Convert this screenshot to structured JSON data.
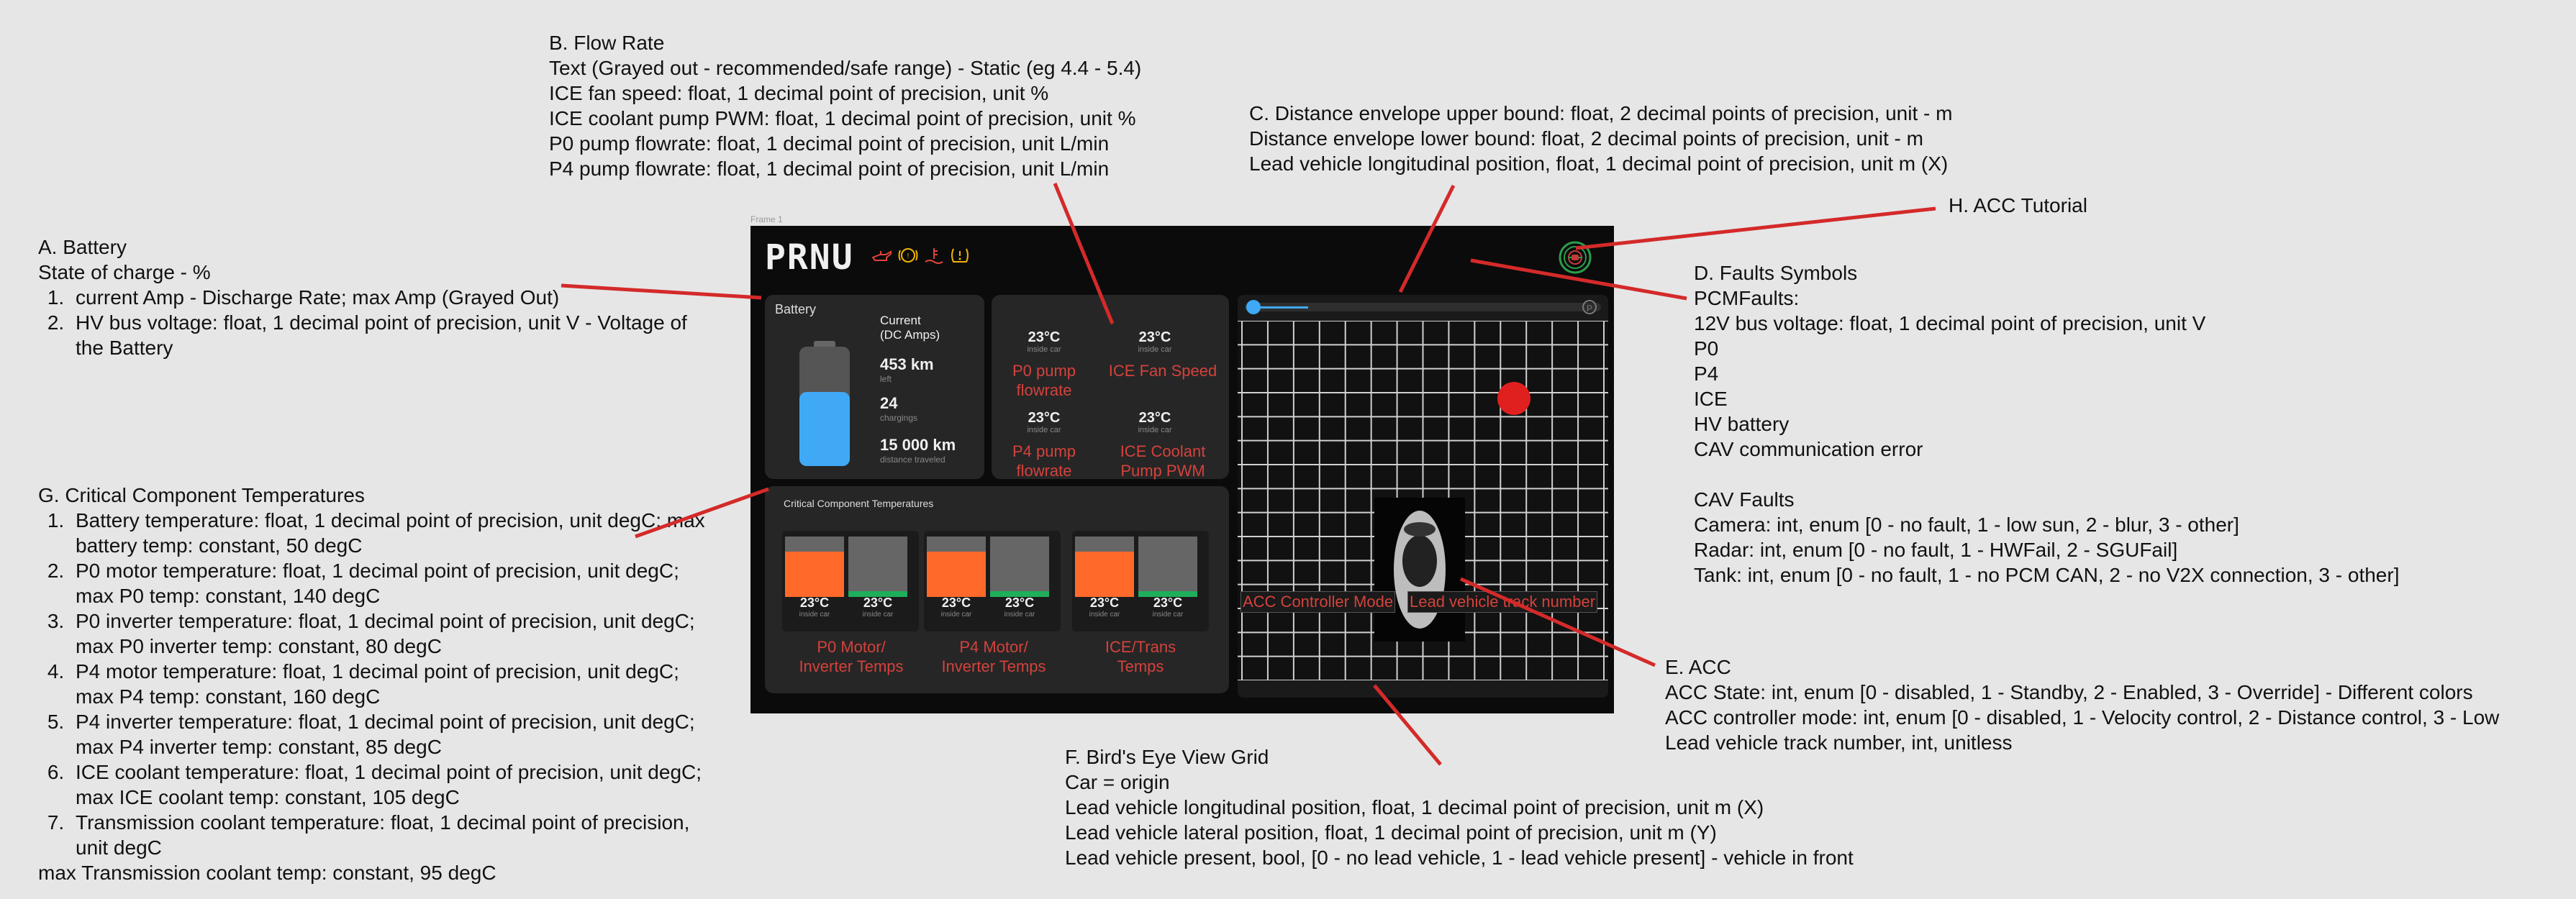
{
  "annotations": {
    "a": {
      "title": "A. Battery",
      "lines": [
        "State of charge - %"
      ],
      "items": [
        "current Amp - Discharge Rate; max Amp (Grayed Out)",
        "HV bus voltage:  float, 1 decimal point of precision, unit V  - Voltage of the Battery"
      ]
    },
    "b": {
      "title": "B. Flow Rate",
      "lines": [
        "Text (Grayed out - recommended/safe range) - Static (eg 4.4 - 5.4)",
        "ICE fan speed: float, 1 decimal point of precision, unit %",
        "ICE coolant pump PWM: float, 1 decimal point of precision, unit %",
        "P0 pump flowrate: float, 1 decimal point of precision, unit L/min",
        "P4 pump flowrate: float, 1 decimal point of precision, unit L/min"
      ]
    },
    "c": {
      "title": "C. Distance envelope upper bound: float, 2 decimal points of precision, unit - m",
      "lines": [
        "Distance envelope lower bound: float, 2 decimal points of precision, unit - m",
        "Lead vehicle longitudinal position, float, 1 decimal point of precision, unit m (X)"
      ]
    },
    "h": {
      "title": "H. ACC Tutorial"
    },
    "d": {
      "title": "D. Faults Symbols",
      "lines": [
        "PCMFaults:",
        "12V bus voltage: float, 1 decimal point of precision, unit V",
        "P0",
        "P4",
        "ICE",
        "HV battery",
        "CAV communication error",
        "",
        "CAV Faults",
        "Camera: int, enum [0 - no fault, 1 - low sun, 2 - blur, 3 - other]",
        "Radar: int, enum [0 - no fault, 1 - HWFail, 2 - SGUFail]",
        "Tank: int, enum [0 - no fault, 1 - no PCM CAN, 2 - no V2X connection, 3 - other]"
      ]
    },
    "e": {
      "title": "E. ACC",
      "lines": [
        "ACC State: int, enum [0 - disabled, 1 - Standby, 2 - Enabled, 3 - Override] - Different colors",
        "ACC controller mode: int, enum [0 - disabled, 1 - Velocity control, 2 - Distance control, 3 - Low",
        "Lead vehicle track number, int, unitless"
      ]
    },
    "f": {
      "title": "F. Bird's Eye View Grid",
      "lines": [
        "Car = origin",
        "Lead vehicle longitudinal position, float, 1 decimal point of precision, unit m (X)",
        "Lead vehicle lateral position, float, 1 decimal point of precision, unit m (Y)",
        "Lead vehicle present, bool, [0 - no lead vehicle, 1 - lead vehicle present] - vehicle in front"
      ]
    },
    "g": {
      "title": "G. Critical Component Temperatures",
      "items": [
        "Battery temperature: float, 1 decimal point of precision, unit degC; max battery temp: constant, 50 degC",
        "P0 motor temperature: float, 1 decimal point of precision, unit degC; max P0 temp: constant, 140 degC",
        "P0 inverter temperature: float, 1 decimal point of precision, unit degC; max P0 inverter temp: constant, 80 degC",
        "P4 motor temperature: float, 1 decimal point of precision, unit degC; max P4 temp: constant, 160 degC",
        "P4 inverter temperature: float, 1 decimal point of precision, unit degC; max P4 inverter temp: constant, 85 degC",
        "ICE coolant temperature: float, 1 decimal point of precision, unit degC; max ICE coolant temp: constant, 105 degC",
        "Transmission coolant temperature: float, 1 decimal point of precision, unit degC"
      ],
      "footer": "max Transmission coolant temp: constant, 95 degC"
    }
  },
  "frame_label": "Frame 1",
  "dashboard": {
    "gear": "PRNU",
    "warning_icons": [
      {
        "icon": "oil-pressure-icon",
        "color": "#e0443a"
      },
      {
        "icon": "engine-warning-icon",
        "color": "#f0b400"
      },
      {
        "icon": "coolant-temp-icon",
        "color": "#e0443a"
      },
      {
        "icon": "tire-pressure-icon",
        "color": "#f0b400"
      }
    ],
    "battery": {
      "title": "Battery",
      "charge_fraction": 0.62,
      "fill_color": "#3fa9f5",
      "stats": [
        {
          "value": "Current\n(DC Amps)",
          "sub": ""
        },
        {
          "value": "453 km",
          "sub": "left"
        },
        {
          "value": "24",
          "sub": "chargings"
        },
        {
          "value": "15 000 km",
          "sub": "distance traveled"
        }
      ]
    },
    "flow": {
      "temps": [
        {
          "value": "23°C",
          "sub": "inside car"
        },
        {
          "value": "23°C",
          "sub": "inside car"
        },
        {
          "value": "23°C",
          "sub": "inside car"
        },
        {
          "value": "23°C",
          "sub": "inside car"
        }
      ],
      "labels": [
        "P0 pump\nflowrate",
        "ICE Fan Speed",
        "P4 pump\nflowrate",
        "ICE Coolant\nPump PWM"
      ]
    },
    "critical": {
      "title": "Critical Component Temperatures",
      "groups": [
        {
          "label": "P0 Motor/\nInverter Temps",
          "gauges": [
            {
              "fill": 0.75,
              "color": "#ff6a2b",
              "value": "23°C",
              "sub": "inside car"
            },
            {
              "fill": 0.1,
              "color": "#1fae5b",
              "value": "23°C",
              "sub": "inside car"
            }
          ]
        },
        {
          "label": "P4 Motor/\nInverter Temps",
          "gauges": [
            {
              "fill": 0.75,
              "color": "#ff6a2b",
              "value": "23°C",
              "sub": "inside car"
            },
            {
              "fill": 0.1,
              "color": "#1fae5b",
              "value": "23°C",
              "sub": "inside car"
            }
          ]
        },
        {
          "label": "ICE/Trans\nTemps",
          "gauges": [
            {
              "fill": 0.75,
              "color": "#ff6a2b",
              "value": "23°C",
              "sub": "inside car"
            },
            {
              "fill": 0.1,
              "color": "#1fae5b",
              "value": "23°C",
              "sub": "inside car"
            }
          ]
        }
      ]
    },
    "acc": {
      "slider_fraction": 0.17,
      "park_icon": "P",
      "controller_mode_label": "ACC Controller Mode",
      "track_number_label": "Lead vehicle track number",
      "lead_vehicle_color": "#e0201f"
    }
  }
}
